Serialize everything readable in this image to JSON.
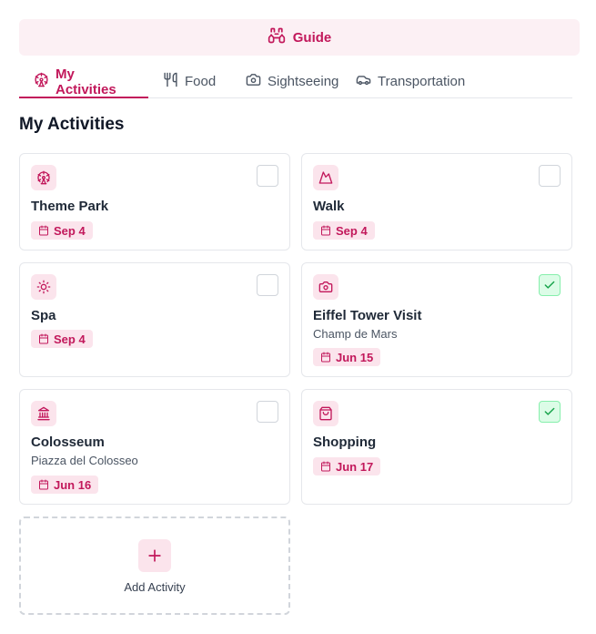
{
  "guide": {
    "label": "Guide",
    "icon": "binoculars-icon"
  },
  "tabs": [
    {
      "label": "My Activities",
      "icon": "ferris-wheel-icon",
      "active": true
    },
    {
      "label": "Food",
      "icon": "utensils-icon",
      "active": false
    },
    {
      "label": "Sightseeing",
      "icon": "camera-icon",
      "active": false
    },
    {
      "label": "Transportation",
      "icon": "car-icon",
      "active": false
    }
  ],
  "section_title": "My Activities",
  "activities": [
    {
      "title": "Theme Park",
      "subtitle": "",
      "date": "Sep 4",
      "checked": false,
      "icon": "ferris-wheel-icon"
    },
    {
      "title": "Walk",
      "subtitle": "",
      "date": "Sep 4",
      "checked": false,
      "icon": "mountain-icon"
    },
    {
      "title": "Spa",
      "subtitle": "",
      "date": "Sep 4",
      "checked": false,
      "icon": "sun-icon"
    },
    {
      "title": "Eiffel Tower Visit",
      "subtitle": "Champ de Mars",
      "date": "Jun 15",
      "checked": true,
      "icon": "camera-icon"
    },
    {
      "title": "Colosseum",
      "subtitle": "Piazza del Colosseo",
      "date": "Jun 16",
      "checked": false,
      "icon": "landmark-icon"
    },
    {
      "title": "Shopping",
      "subtitle": "",
      "date": "Jun 17",
      "checked": true,
      "icon": "shopping-bag-icon"
    }
  ],
  "add_activity": {
    "label": "Add Activity",
    "icon": "plus-icon"
  },
  "colors": {
    "accent": "#c2185b",
    "accent_bg": "#fbe4ec",
    "check_bg": "#dcfce7",
    "check": "#16a34a"
  }
}
